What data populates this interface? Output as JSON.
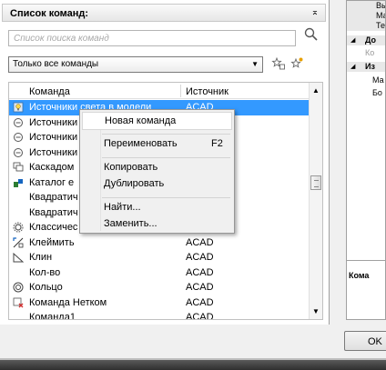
{
  "panel": {
    "title": "Список команд:",
    "collapse_glyph": "⌅"
  },
  "search": {
    "placeholder": "Список поиска команд"
  },
  "filter": {
    "selected": "Только все команды"
  },
  "list": {
    "columns": {
      "command": "Команда",
      "source": "Источник"
    },
    "rows": [
      {
        "name": "Источники света в модели",
        "source": "ACAD",
        "icon": "light-bulb-icon",
        "selected": true
      },
      {
        "name": "Источники",
        "source": "",
        "icon": "light-source-icon"
      },
      {
        "name": "Источники",
        "source": "",
        "icon": "light-source-icon"
      },
      {
        "name": "Источники",
        "source": "",
        "icon": "light-source-icon"
      },
      {
        "name": "Каскадом",
        "source": "",
        "icon": "cascade-windows-icon"
      },
      {
        "name": "Каталог е",
        "source": "",
        "icon": "catalog-icon"
      },
      {
        "name": "Квадратич",
        "source": "",
        "icon": ""
      },
      {
        "name": "Квадратич",
        "source": "",
        "icon": ""
      },
      {
        "name": "Классичес",
        "source": "",
        "icon": "classic-gear-icon"
      },
      {
        "name": "Клеймить",
        "source": "ACAD",
        "icon": "stamp-icon"
      },
      {
        "name": "Клин",
        "source": "ACAD",
        "icon": "wedge-icon"
      },
      {
        "name": "Кол-во",
        "source": "ACAD",
        "icon": ""
      },
      {
        "name": "Кольцо",
        "source": "ACAD",
        "icon": "donut-icon"
      },
      {
        "name": "Команда Нетком",
        "source": "ACAD",
        "icon": "command-netcom-icon"
      },
      {
        "name": "Команда1",
        "source": "ACAD",
        "icon": ""
      }
    ]
  },
  "context_menu": {
    "items": [
      {
        "label": "Новая команда",
        "shortcut": ""
      },
      {
        "label": "Переименовать",
        "shortcut": "F2"
      },
      {
        "label": "Копировать",
        "shortcut": ""
      },
      {
        "label": "Дублировать",
        "shortcut": ""
      },
      {
        "label": "Найти...",
        "shortcut": ""
      },
      {
        "label": "Заменить...",
        "shortcut": ""
      }
    ]
  },
  "right_panel": {
    "lines": [
      "Вы",
      "Ма",
      "Те",
      "До",
      "Ко",
      "Из",
      "Ма",
      "Бо"
    ],
    "footer": "Кома"
  },
  "buttons": {
    "ok": "OK"
  },
  "colors": {
    "selection": "#3399ff",
    "header_bg": "#e6e6e6",
    "menu_bg": "#f0f0f0"
  }
}
